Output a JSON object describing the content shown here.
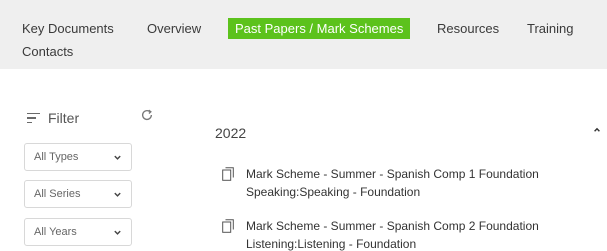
{
  "nav": {
    "items": [
      {
        "label": "Key Documents",
        "active": false
      },
      {
        "label": "Overview",
        "active": false
      },
      {
        "label": "Past Papers / Mark Schemes",
        "active": true
      },
      {
        "label": "Resources",
        "active": false
      },
      {
        "label": "Training",
        "active": false
      },
      {
        "label": "Contacts",
        "active": false
      }
    ],
    "active_color": "#5cc21c",
    "background": "#efefef"
  },
  "filter": {
    "label": "Filter",
    "icon": "filter-icon",
    "refresh_icon": "refresh-icon",
    "selects": [
      {
        "value": "All Types"
      },
      {
        "value": "All Series"
      },
      {
        "value": "All Years"
      }
    ]
  },
  "results": {
    "year": "2022",
    "toggle_icon": "chevron-up-icon",
    "documents": [
      {
        "icon": "copy-document-icon",
        "line1": "Mark Scheme - Summer - Spanish Comp 1 Foundation",
        "line2": "Speaking:Speaking - Foundation"
      },
      {
        "icon": "copy-document-icon",
        "line1": "Mark Scheme - Summer - Spanish Comp 2 Foundation",
        "line2": "Listening:Listening - Foundation"
      }
    ]
  }
}
